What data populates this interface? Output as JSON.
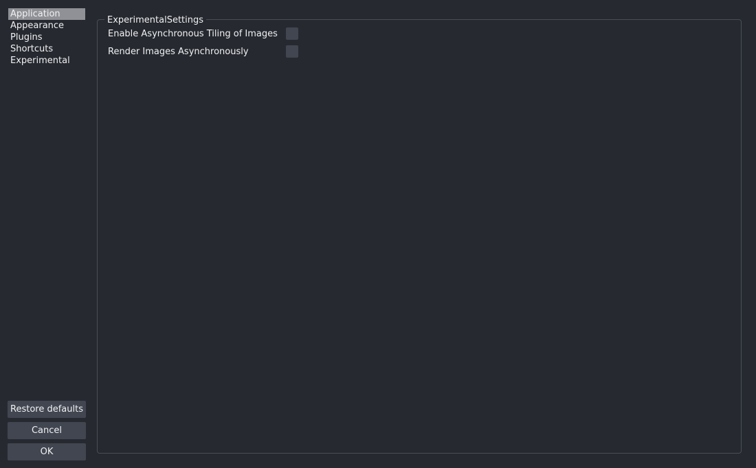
{
  "sidebar": {
    "items": [
      {
        "label": "Application",
        "selected": true
      },
      {
        "label": "Appearance",
        "selected": false
      },
      {
        "label": "Plugins",
        "selected": false
      },
      {
        "label": "Shortcuts",
        "selected": false
      },
      {
        "label": "Experimental",
        "selected": false
      }
    ]
  },
  "buttons": {
    "restore": "Restore defaults",
    "cancel": "Cancel",
    "ok": "OK"
  },
  "group": {
    "title": "ExperimentalSettings",
    "options": [
      {
        "label": "Enable Asynchronous Tiling of Images",
        "checked": false
      },
      {
        "label": "Render Images Asynchronously",
        "checked": false
      }
    ]
  }
}
